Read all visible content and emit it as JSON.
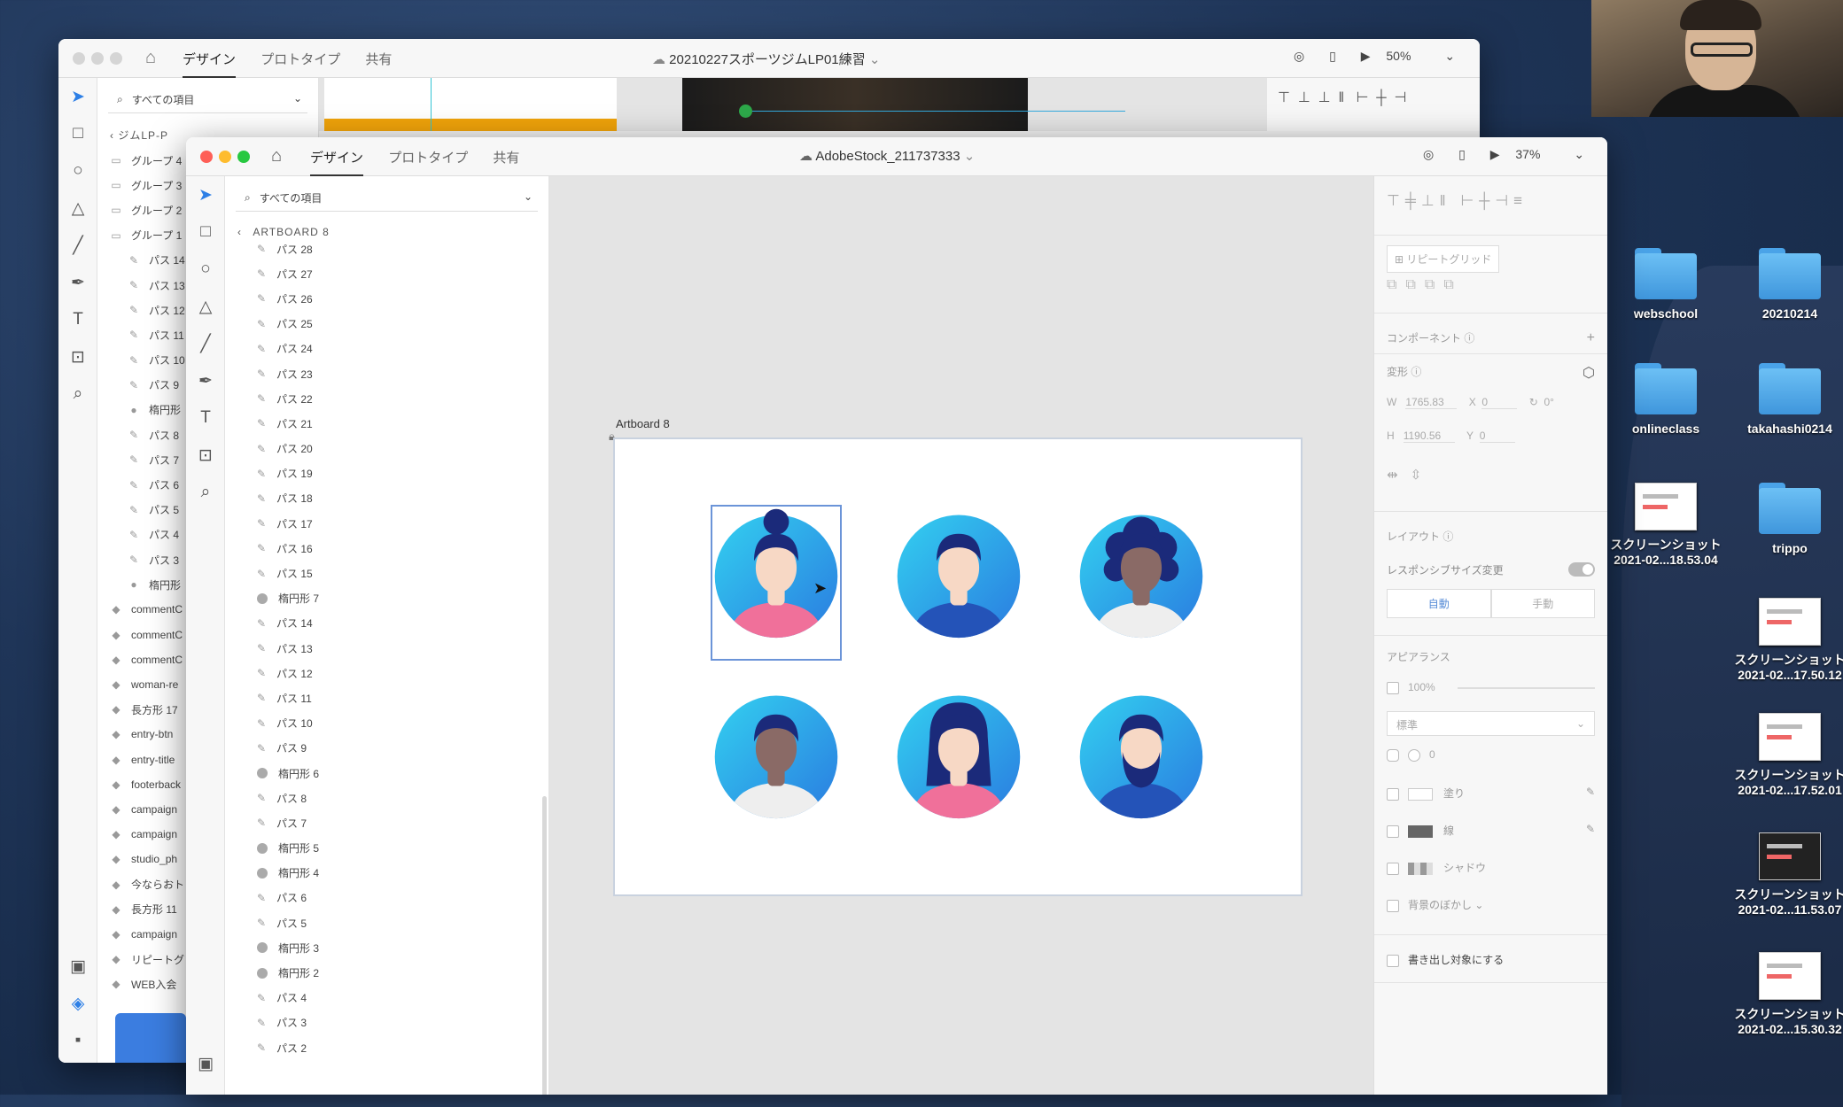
{
  "webcam": {
    "label": ""
  },
  "desktop": {
    "icons": [
      {
        "label": "webschool",
        "type": "folder"
      },
      {
        "label": "20210214",
        "type": "folder"
      },
      {
        "label": "onlineclass",
        "type": "folder"
      },
      {
        "label": "takahashi0214",
        "type": "folder"
      },
      {
        "label": "スクリーンショット 2021-02...18.53.04",
        "type": "screenshot"
      },
      {
        "label": "trippo",
        "type": "folder"
      },
      {
        "label": "スクリーンショット 2021-02...17.50.12",
        "type": "screenshot"
      },
      {
        "label": "スクリーンショット 2021-02...17.52.01",
        "type": "screenshot"
      },
      {
        "label": "スクリーンショット 2021-02...11.53.07",
        "type": "screenshot"
      },
      {
        "label": "スクリーンショット 2021-02...15.30.32",
        "type": "screenshot"
      }
    ]
  },
  "back_window": {
    "tabs": [
      "デザイン",
      "プロトタイプ",
      "共有"
    ],
    "title": "20210227スポーツジムLP01練習",
    "zoom": "50%",
    "search_placeholder": "すべての項目",
    "breadcrumb": "ジムLP-P",
    "layers": [
      "グループ 4",
      "グループ 3",
      "グループ 2",
      "グループ 1",
      "パス 14",
      "パス 13",
      "パス 12",
      "パス 11",
      "パス 10",
      "パス 9",
      "楕円形",
      "パス 8",
      "パス 7",
      "パス 6",
      "パス 5",
      "パス 4",
      "パス 3",
      "楕円形",
      "commentC",
      "commentC",
      "commentC",
      "woman-re",
      "長方形 17",
      "entry-btn",
      "entry-title",
      "footerback",
      "campaign",
      "campaign",
      "studio_ph",
      "今ならおト",
      "長方形 11",
      "campaign",
      "リピートグ",
      "WEB入会"
    ]
  },
  "front_window": {
    "tabs": [
      "デザイン",
      "プロトタイプ",
      "共有"
    ],
    "title": "AdobeStock_211737333",
    "zoom": "37%",
    "search_placeholder": "すべての項目",
    "breadcrumb": "ARTBOARD 8",
    "layers": [
      {
        "name": "パス 28",
        "kind": "path"
      },
      {
        "name": "パス 27",
        "kind": "path"
      },
      {
        "name": "パス 26",
        "kind": "path"
      },
      {
        "name": "パス 25",
        "kind": "path"
      },
      {
        "name": "パス 24",
        "kind": "path"
      },
      {
        "name": "パス 23",
        "kind": "path"
      },
      {
        "name": "パス 22",
        "kind": "path"
      },
      {
        "name": "パス 21",
        "kind": "path"
      },
      {
        "name": "パス 20",
        "kind": "path"
      },
      {
        "name": "パス 19",
        "kind": "path"
      },
      {
        "name": "パス 18",
        "kind": "path"
      },
      {
        "name": "パス 17",
        "kind": "path"
      },
      {
        "name": "パス 16",
        "kind": "path"
      },
      {
        "name": "パス 15",
        "kind": "path"
      },
      {
        "name": "楕円形 7",
        "kind": "ellipse"
      },
      {
        "name": "パス 14",
        "kind": "path"
      },
      {
        "name": "パス 13",
        "kind": "path"
      },
      {
        "name": "パス 12",
        "kind": "path"
      },
      {
        "name": "パス 11",
        "kind": "path"
      },
      {
        "name": "パス 10",
        "kind": "path"
      },
      {
        "name": "パス 9",
        "kind": "path"
      },
      {
        "name": "楕円形 6",
        "kind": "ellipse"
      },
      {
        "name": "パス 8",
        "kind": "path"
      },
      {
        "name": "パス 7",
        "kind": "path"
      },
      {
        "name": "楕円形 5",
        "kind": "ellipse"
      },
      {
        "name": "楕円形 4",
        "kind": "ellipse"
      },
      {
        "name": "パス 6",
        "kind": "path"
      },
      {
        "name": "パス 5",
        "kind": "path"
      },
      {
        "name": "楕円形 3",
        "kind": "ellipse"
      },
      {
        "name": "楕円形 2",
        "kind": "ellipse"
      },
      {
        "name": "パス 4",
        "kind": "path"
      },
      {
        "name": "パス 3",
        "kind": "path"
      },
      {
        "name": "パス 2",
        "kind": "path"
      }
    ],
    "artboard_label": "Artboard 8",
    "avatars": [
      {
        "id": "woman-bun",
        "shirt": "#f0709a",
        "skin": "#f7d8c5",
        "hair": "#1b2a7a"
      },
      {
        "id": "man-short",
        "shirt": "#2453b8",
        "skin": "#f7d8c5",
        "hair": "#1b2a7a"
      },
      {
        "id": "woman-curly",
        "shirt": "#eeeeee",
        "skin": "#8a6a66",
        "hair": "#1b2a7a"
      },
      {
        "id": "man-dark",
        "shirt": "#eeeeee",
        "skin": "#8a6a66",
        "hair": "#1b2a7a"
      },
      {
        "id": "woman-long",
        "shirt": "#f0709a",
        "skin": "#f7d8c5",
        "hair": "#1b2a7a"
      },
      {
        "id": "man-beard",
        "shirt": "#2453b8",
        "skin": "#f7d8c5",
        "hair": "#1b2a7a"
      }
    ],
    "props": {
      "repeat_grid": "リピートグリッド",
      "component": "コンポーネント",
      "transform": "変形",
      "w_label": "W",
      "w_value": "1765.83",
      "x_label": "X",
      "x_value": "0",
      "rotation": "0°",
      "h_label": "H",
      "h_value": "1190.56",
      "y_label": "Y",
      "y_value": "0",
      "layout": "レイアウト",
      "responsive": "レスポンシブサイズ変更",
      "auto": "自動",
      "manual": "手動",
      "appearance": "アピアランス",
      "opacity": "100%",
      "blend": "標準",
      "radius": "0",
      "fill": "塗り",
      "stroke": "線",
      "shadow": "シャドウ",
      "bg_blur": "背景のぼかし",
      "export": "書き出し対象にする"
    }
  }
}
